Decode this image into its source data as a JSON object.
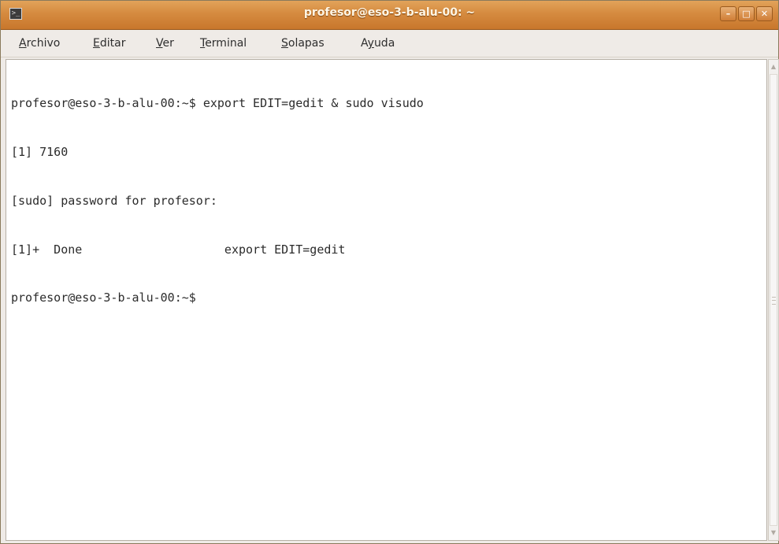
{
  "window": {
    "title": "profesor@eso-3-b-alu-00: ~",
    "icon": "terminal-icon",
    "controls": {
      "minimize": "minimize-icon",
      "maximize": "maximize-icon",
      "close": "close-icon"
    }
  },
  "menubar": {
    "items": [
      {
        "pre": "",
        "mnemonic": "A",
        "post": "rchivo"
      },
      {
        "pre": "",
        "mnemonic": "E",
        "post": "ditar"
      },
      {
        "pre": "",
        "mnemonic": "V",
        "post": "er"
      },
      {
        "pre": "",
        "mnemonic": "T",
        "post": "erminal"
      },
      {
        "pre": "",
        "mnemonic": "S",
        "post": "olapas"
      },
      {
        "pre": "A",
        "mnemonic": "y",
        "post": "uda"
      }
    ]
  },
  "terminal": {
    "lines": [
      "profesor@eso-3-b-alu-00:~$ export EDIT=gedit & sudo visudo",
      "[1] 7160",
      "[sudo] password for profesor:",
      "[1]+  Done                    export EDIT=gedit",
      "profesor@eso-3-b-alu-00:~$ "
    ]
  },
  "colors": {
    "titlebar": "#d58a3f",
    "menubar": "#efebe7",
    "terminal_bg": "#ffffff",
    "terminal_fg": "#2b2b2b"
  }
}
